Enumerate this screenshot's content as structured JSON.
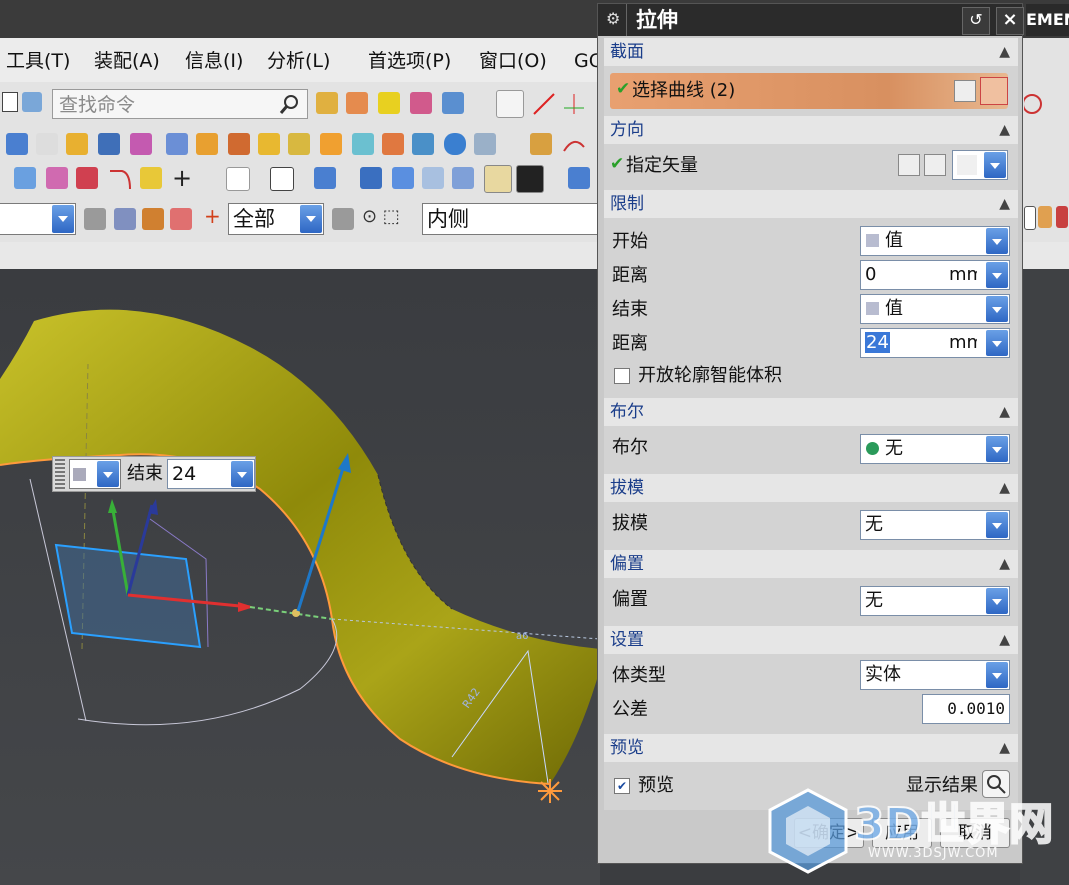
{
  "app": {
    "brand_fragment": "EMEN"
  },
  "menu": {
    "items": [
      "工具(T)",
      "装配(A)",
      "信息(I)",
      "分析(L)",
      "首选项(P)",
      "窗口(O)",
      "GC"
    ]
  },
  "search": {
    "placeholder": "查找命令"
  },
  "filters": {
    "scope": "全部",
    "mode": "内侧"
  },
  "onscreen_input": {
    "label": "结束",
    "value": "24"
  },
  "dialog": {
    "title": "拉伸",
    "sections": {
      "section": {
        "header": "截面",
        "select_curve": "选择曲线 (2)"
      },
      "direction": {
        "header": "方向",
        "specify_vector": "指定矢量"
      },
      "limits": {
        "header": "限制",
        "start_label": "开始",
        "start_value": "值",
        "start_distance_label": "距离",
        "start_distance": "0",
        "start_unit": "mm",
        "end_label": "结束",
        "end_value": "值",
        "end_distance_label": "距离",
        "end_distance": "24",
        "end_unit": "mm",
        "open_profile": "开放轮廓智能体积"
      },
      "boolean": {
        "header": "布尔",
        "label": "布尔",
        "value": "无"
      },
      "draft": {
        "header": "拔模",
        "label": "拔模",
        "value": "无"
      },
      "offset": {
        "header": "偏置",
        "label": "偏置",
        "value": "无"
      },
      "settings": {
        "header": "设置",
        "body_type_label": "体类型",
        "body_type": "实体",
        "tolerance_label": "公差",
        "tolerance": "0.0010"
      },
      "preview": {
        "header": "预览",
        "preview_label": "预览",
        "preview_checked": true,
        "show_result": "显示结果"
      }
    },
    "buttons": {
      "ok": "<确定>",
      "apply": "应用",
      "cancel": "取消"
    }
  },
  "watermark": {
    "text": "3D世界网",
    "url": "WWW.3DSJW.COM"
  },
  "colors": {
    "surface": "#a8a212",
    "edge": "#ff9a3c",
    "selected_row": "#e8a070",
    "section_header_text": "#1a3d8a",
    "dropdown_blue": "#2e67c4"
  }
}
